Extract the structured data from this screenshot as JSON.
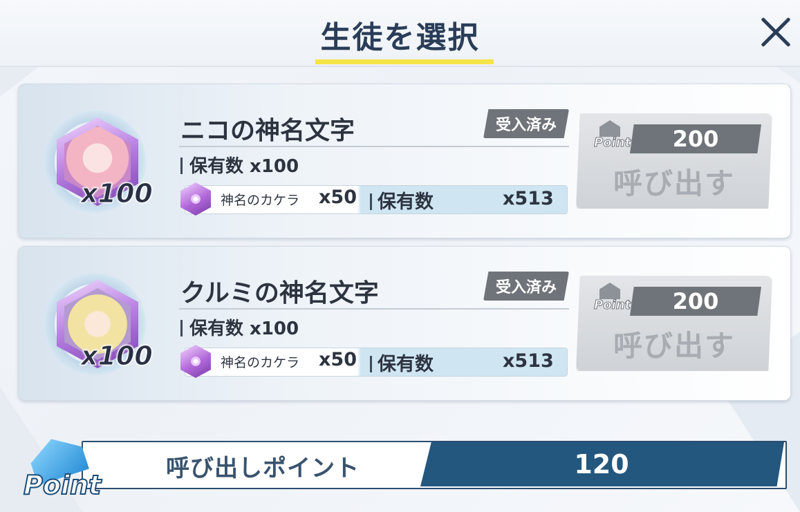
{
  "header": {
    "title": "生徒を選択",
    "close_icon": "close-icon"
  },
  "students": [
    {
      "name": "ニコの神名文字",
      "badge": "受入済み",
      "avatar_count": "x100",
      "owned": "保有数 x100",
      "material_name": "神名のカケラ",
      "material_required": "x50",
      "material_owned_label": "保有数",
      "material_owned_value": "x513",
      "point_label": "Point",
      "cost": "200",
      "call_label": "呼び出す"
    },
    {
      "name": "クルミの神名文字",
      "badge": "受入済み",
      "avatar_count": "x100",
      "owned": "保有数 x100",
      "material_name": "神名のカケラ",
      "material_required": "x50",
      "material_owned_label": "保有数",
      "material_owned_value": "x513",
      "point_label": "Point",
      "cost": "200",
      "call_label": "呼び出す"
    }
  ],
  "footer": {
    "points_label": "呼び出しポイント",
    "points_value": "120",
    "point_icon_label": "Point"
  },
  "colors": {
    "accent": "#f5e34a",
    "navy": "#24577e",
    "badge_gray": "#6f747a"
  }
}
